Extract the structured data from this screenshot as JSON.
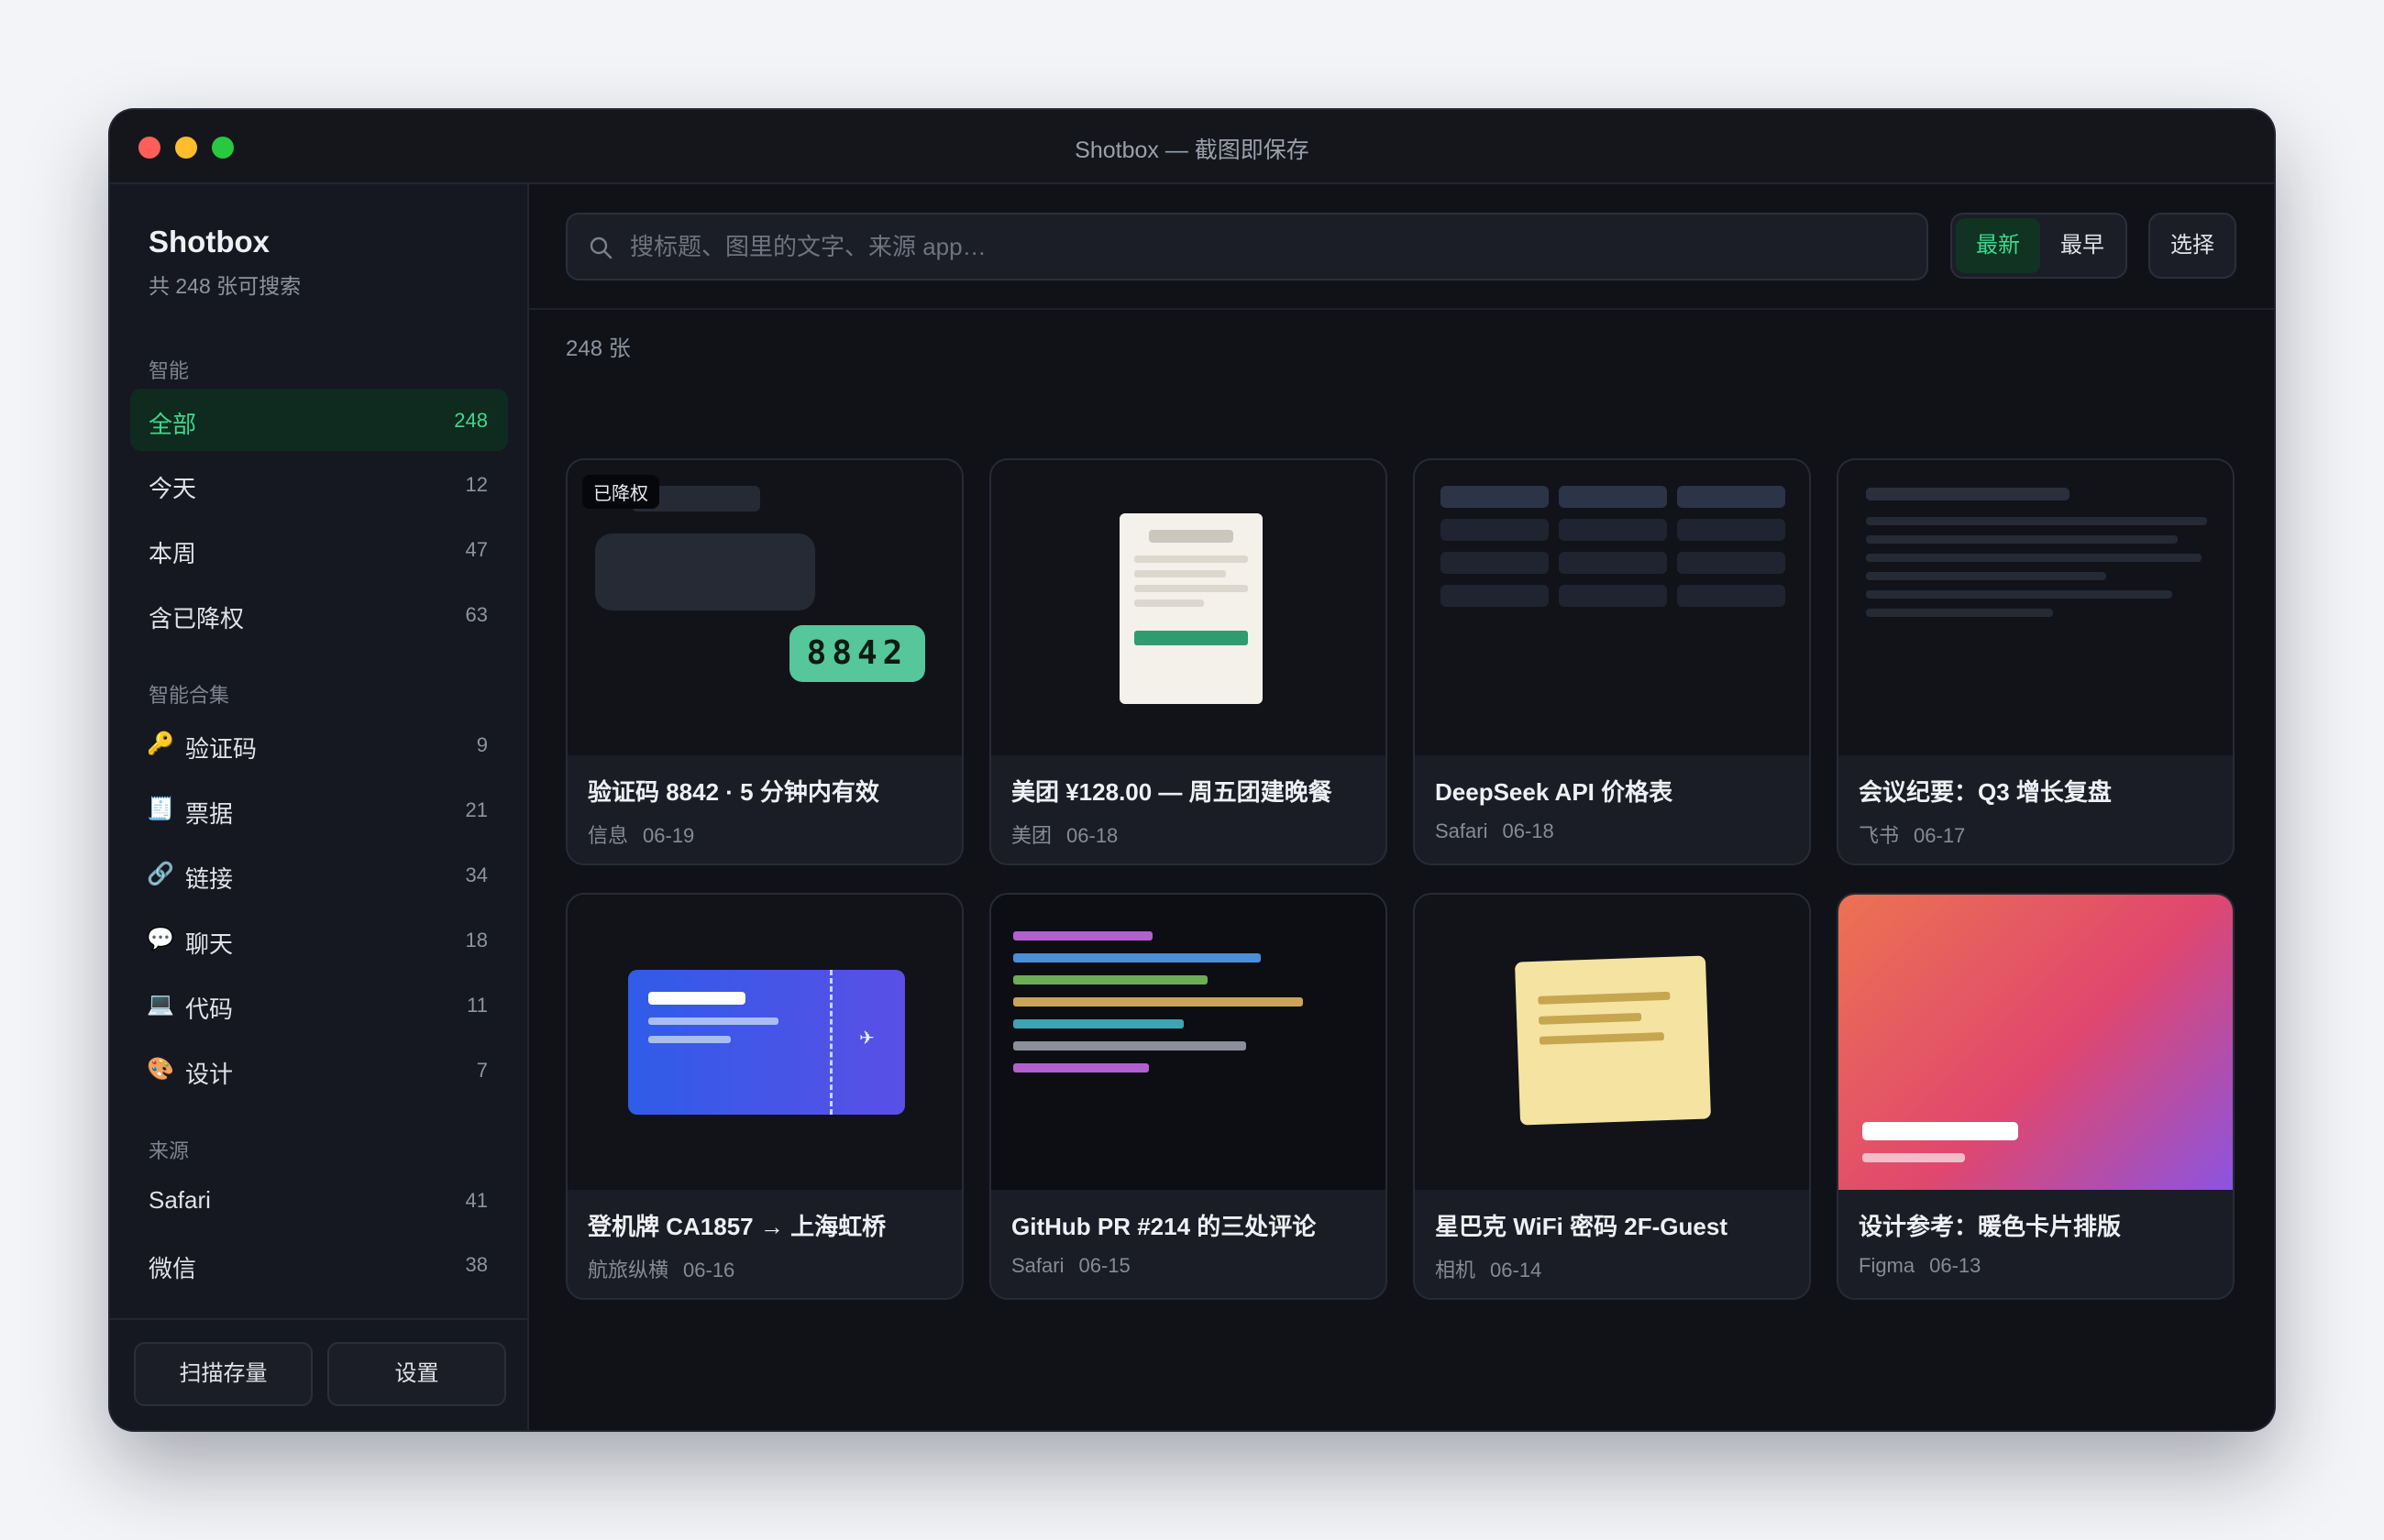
{
  "window": {
    "title": "Shotbox — 截图即保存"
  },
  "sidebar": {
    "app_name": "Shotbox",
    "subtitle": "共 248 张可搜索",
    "sections": {
      "smart": "智能",
      "collections": "智能合集",
      "sources": "来源"
    },
    "smart_items": [
      {
        "label": "全部",
        "count": "248",
        "active": true
      },
      {
        "label": "今天",
        "count": "12"
      },
      {
        "label": "本周",
        "count": "47"
      },
      {
        "label": "含已降权",
        "count": "63"
      }
    ],
    "collection_items": [
      {
        "icon": "🔑",
        "label": "验证码",
        "count": "9"
      },
      {
        "icon": "🧾",
        "label": "票据",
        "count": "21"
      },
      {
        "icon": "🔗",
        "label": "链接",
        "count": "34"
      },
      {
        "icon": "💬",
        "label": "聊天",
        "count": "18"
      },
      {
        "icon": "💻",
        "label": "代码",
        "count": "11"
      },
      {
        "icon": "🎨",
        "label": "设计",
        "count": "7"
      }
    ],
    "source_items": [
      {
        "label": "Safari",
        "count": "41"
      },
      {
        "label": "微信",
        "count": "38"
      }
    ],
    "buttons": {
      "scan": "扫描存量",
      "settings": "设置"
    }
  },
  "toolbar": {
    "search_placeholder": "搜标题、图里的文字、来源 app…",
    "sort_newest": "最新",
    "sort_oldest": "最早",
    "select": "选择"
  },
  "grid": {
    "count_label": "248 张",
    "cards": [
      {
        "title": "验证码 8842 · 5 分钟内有效",
        "source": "信息",
        "date": "06-19",
        "badge": "已降权",
        "code": "8842"
      },
      {
        "title": "美团 ¥128.00 — 周五团建晚餐",
        "source": "美团",
        "date": "06-18"
      },
      {
        "title": "DeepSeek API 价格表",
        "source": "Safari",
        "date": "06-18"
      },
      {
        "title": "会议纪要：Q3 增长复盘",
        "source": "飞书",
        "date": "06-17"
      },
      {
        "title": "登机牌 CA1857 → 上海虹桥",
        "source": "航旅纵横",
        "date": "06-16"
      },
      {
        "title": "GitHub PR #214 的三处评论",
        "source": "Safari",
        "date": "06-15"
      },
      {
        "title": "星巴克 WiFi 密码 2F-Guest",
        "source": "相机",
        "date": "06-14"
      },
      {
        "title": "设计参考：暖色卡片排版",
        "source": "Figma",
        "date": "06-13"
      }
    ]
  },
  "colors": {
    "accent": "#3ed88e",
    "background": "#101218"
  }
}
